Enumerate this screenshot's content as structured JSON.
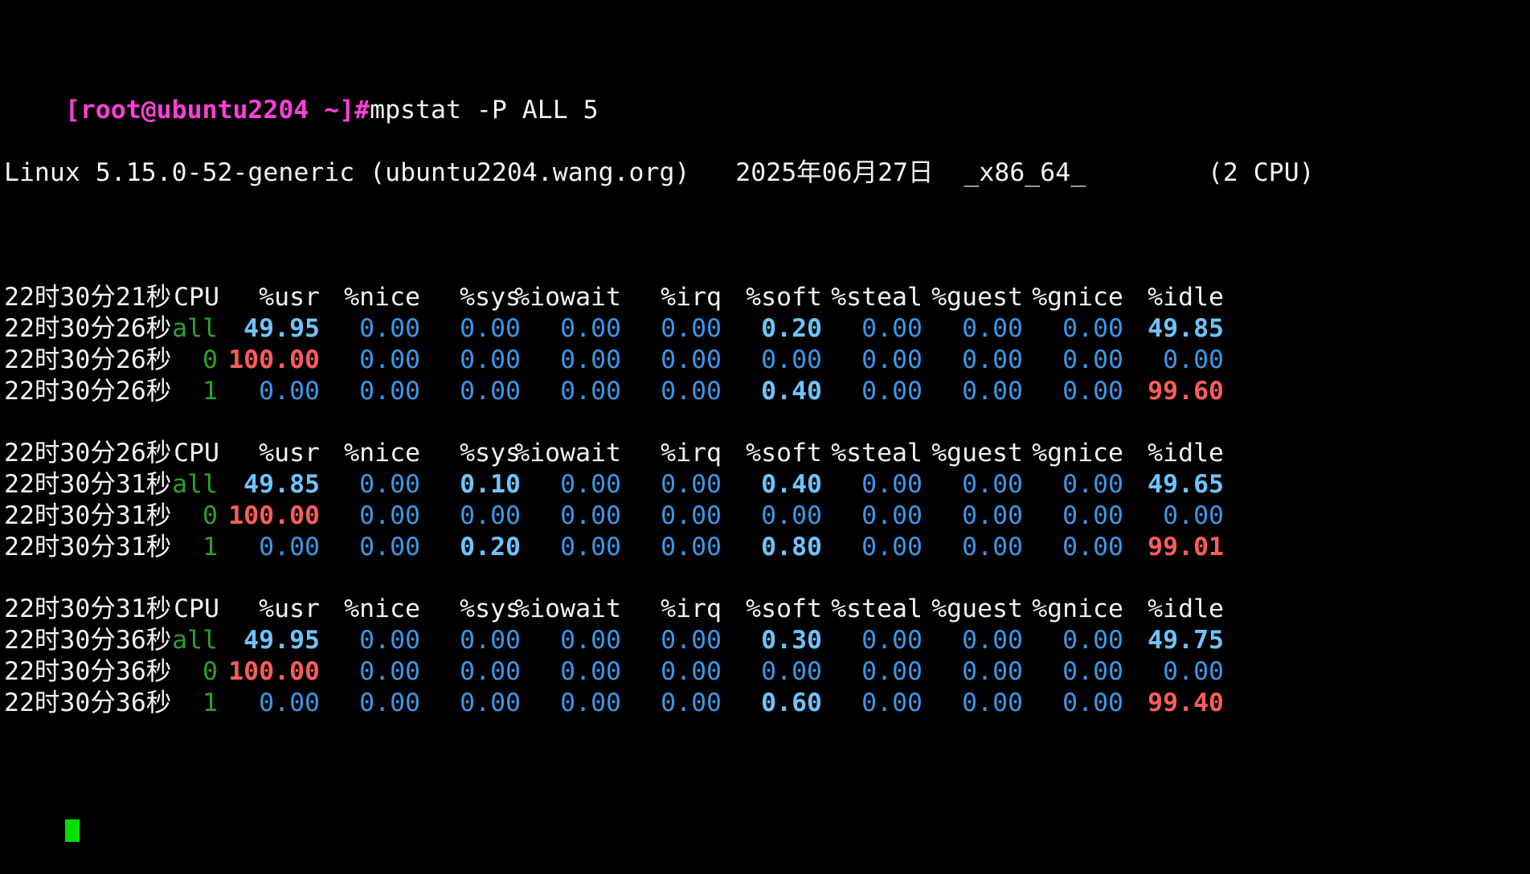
{
  "prompt": {
    "text": "[root@ubuntu2204 ~]#",
    "command": "mpstat -P ALL 5"
  },
  "sysinfo": "Linux 5.15.0-52-generic (ubuntu2204.wang.org)   2025年06月27日  _x86_64_        (2 CPU)",
  "columns": [
    "CPU",
    "%usr",
    "%nice",
    "%sys",
    "%iowait",
    "%irq",
    "%soft",
    "%steal",
    "%guest",
    "%gnice",
    "%idle"
  ],
  "blocks": [
    {
      "header_time": "22时30分21秒",
      "rows": [
        {
          "time": "22时30分26秒",
          "cpu": "all",
          "usr": "49.95",
          "nice": "0.00",
          "sys": "0.00",
          "iowait": "0.00",
          "irq": "0.00",
          "soft": "0.20",
          "steal": "0.00",
          "guest": "0.00",
          "gnice": "0.00",
          "idle": "49.85"
        },
        {
          "time": "22时30分26秒",
          "cpu": "0",
          "usr": "100.00",
          "nice": "0.00",
          "sys": "0.00",
          "iowait": "0.00",
          "irq": "0.00",
          "soft": "0.00",
          "steal": "0.00",
          "guest": "0.00",
          "gnice": "0.00",
          "idle": "0.00"
        },
        {
          "time": "22时30分26秒",
          "cpu": "1",
          "usr": "0.00",
          "nice": "0.00",
          "sys": "0.00",
          "iowait": "0.00",
          "irq": "0.00",
          "soft": "0.40",
          "steal": "0.00",
          "guest": "0.00",
          "gnice": "0.00",
          "idle": "99.60"
        }
      ]
    },
    {
      "header_time": "22时30分26秒",
      "rows": [
        {
          "time": "22时30分31秒",
          "cpu": "all",
          "usr": "49.85",
          "nice": "0.00",
          "sys": "0.10",
          "iowait": "0.00",
          "irq": "0.00",
          "soft": "0.40",
          "steal": "0.00",
          "guest": "0.00",
          "gnice": "0.00",
          "idle": "49.65"
        },
        {
          "time": "22时30分31秒",
          "cpu": "0",
          "usr": "100.00",
          "nice": "0.00",
          "sys": "0.00",
          "iowait": "0.00",
          "irq": "0.00",
          "soft": "0.00",
          "steal": "0.00",
          "guest": "0.00",
          "gnice": "0.00",
          "idle": "0.00"
        },
        {
          "time": "22时30分31秒",
          "cpu": "1",
          "usr": "0.00",
          "nice": "0.00",
          "sys": "0.20",
          "iowait": "0.00",
          "irq": "0.00",
          "soft": "0.80",
          "steal": "0.00",
          "guest": "0.00",
          "gnice": "0.00",
          "idle": "99.01"
        }
      ]
    },
    {
      "header_time": "22时30分31秒",
      "rows": [
        {
          "time": "22时30分36秒",
          "cpu": "all",
          "usr": "49.95",
          "nice": "0.00",
          "sys": "0.00",
          "iowait": "0.00",
          "irq": "0.00",
          "soft": "0.30",
          "steal": "0.00",
          "guest": "0.00",
          "gnice": "0.00",
          "idle": "49.75"
        },
        {
          "time": "22时30分36秒",
          "cpu": "0",
          "usr": "100.00",
          "nice": "0.00",
          "sys": "0.00",
          "iowait": "0.00",
          "irq": "0.00",
          "soft": "0.00",
          "steal": "0.00",
          "guest": "0.00",
          "gnice": "0.00",
          "idle": "0.00"
        },
        {
          "time": "22时30分36秒",
          "cpu": "1",
          "usr": "0.00",
          "nice": "0.00",
          "sys": "0.00",
          "iowait": "0.00",
          "irq": "0.00",
          "soft": "0.60",
          "steal": "0.00",
          "guest": "0.00",
          "gnice": "0.00",
          "idle": "99.40"
        }
      ]
    }
  ],
  "colors": {
    "background": "#000000",
    "prompt": "#ff3fd6",
    "cpu_label": "#2aa12a",
    "value": "#3a97e8",
    "value_highlight": "#6fc3ff",
    "value_alert": "#ff5c5c",
    "cursor": "#00e000"
  }
}
